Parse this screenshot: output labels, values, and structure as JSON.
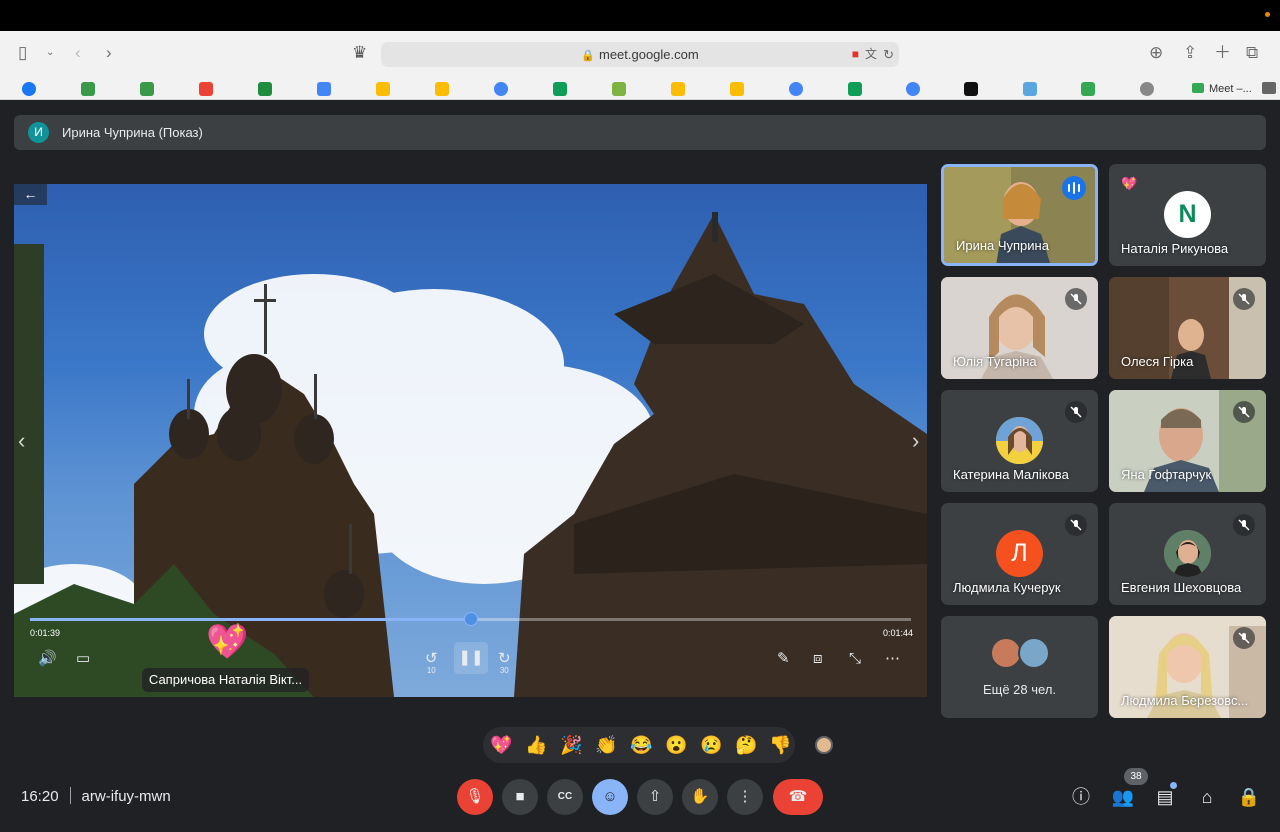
{
  "browser": {
    "url": "meet.google.com",
    "tab_label": "Meet –..."
  },
  "presenter_bar": {
    "avatar_initial": "И",
    "title": "Ирина Чуприна (Показ)"
  },
  "player": {
    "current_time": "0:01:39",
    "total_time": "0:01:44",
    "progress_fraction": 0.5,
    "rewind_label": "10",
    "forward_label": "30",
    "reaction_emoji": "💖",
    "speaker_name": "Сапричова Наталія Вікт..."
  },
  "participants": [
    {
      "name": "Ирина Чуприна",
      "state": "speaking"
    },
    {
      "name": "Наталія Рикунова",
      "avatar_letter": "N",
      "reaction": "💖"
    },
    {
      "name": "Юлія Тугаріна",
      "state": "muted"
    },
    {
      "name": "Олеся Гірка",
      "state": "muted"
    },
    {
      "name": "Катерина Малікова",
      "state": "muted"
    },
    {
      "name": "Яна Гофтарчук",
      "state": "muted"
    },
    {
      "name": "Людмила Кучерук",
      "avatar_letter": "Л",
      "state": "muted"
    },
    {
      "name": "Евгения Шеховцова",
      "state": "muted"
    },
    {
      "name": "Ещё 28 чел."
    },
    {
      "name": "Людмила Березовс...",
      "state": "muted"
    }
  ],
  "emoji_reactions": [
    "💖",
    "👍",
    "🎉",
    "👏",
    "😂",
    "😮",
    "😢",
    "🤔",
    "👎"
  ],
  "bottom": {
    "time": "16:20",
    "meeting_code": "arw-ifuy-mwn",
    "participant_count": "38"
  },
  "colors": {
    "background": "#202124",
    "tile": "#3c4043",
    "accent": "#8ab4f8",
    "danger": "#ea4335"
  }
}
